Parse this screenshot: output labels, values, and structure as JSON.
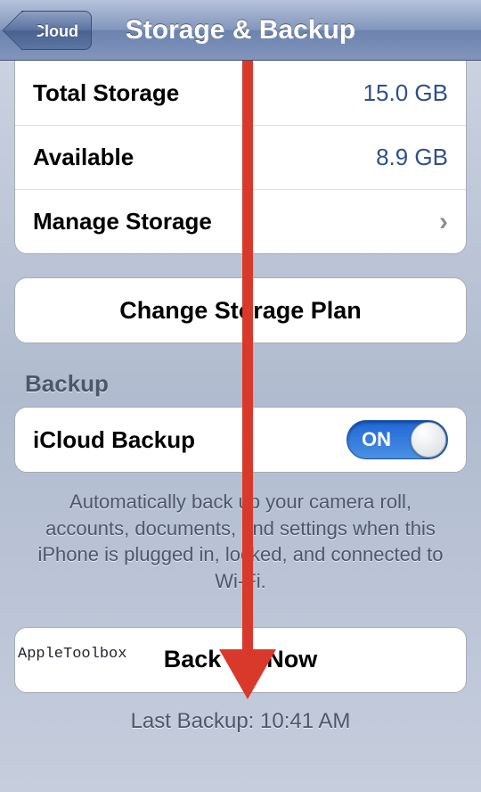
{
  "nav": {
    "back_label": "iCloud",
    "title": "Storage & Backup"
  },
  "storage": {
    "total_label": "Total Storage",
    "total_value": "15.0 GB",
    "available_label": "Available",
    "available_value": "8.9 GB",
    "manage_label": "Manage Storage"
  },
  "change_plan_label": "Change Storage Plan",
  "backup": {
    "section_header": "Backup",
    "toggle_label": "iCloud Backup",
    "toggle_state": "ON",
    "description": "Automatically back up your camera roll, accounts, documents, and settings when this iPhone is plugged in, locked, and connected to Wi-Fi.",
    "backup_now_label": "Back Up Now",
    "last_backup": "Last Backup: 10:41 AM"
  },
  "watermark": "AppleToolbox"
}
